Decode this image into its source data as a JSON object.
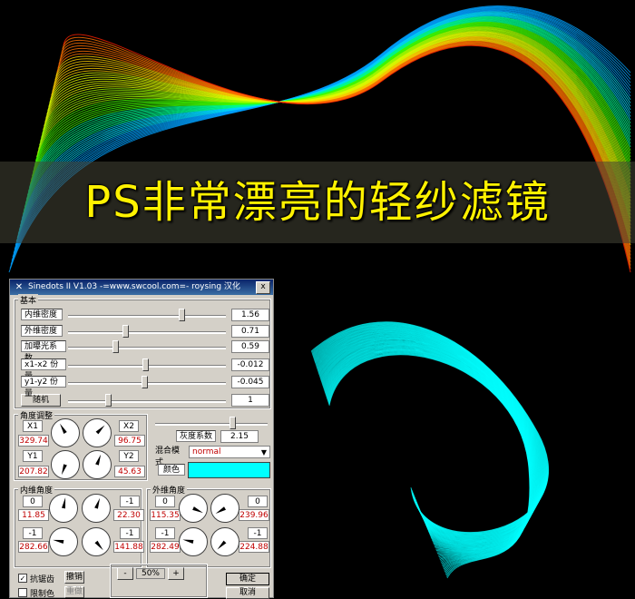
{
  "banner": {
    "title": "PS非常漂亮的轻纱滤镜"
  },
  "window": {
    "title": "Sinedots II V1.03 -=www.swcool.com=- roysing 汉化",
    "close_glyph": "x",
    "section_basic": "基本",
    "params": [
      {
        "label": "内维密度",
        "value": "1.56",
        "level": 0.72
      },
      {
        "label": "外维密度",
        "value": "0.71",
        "level": 0.36
      },
      {
        "label": "加曝光系数",
        "value": "0.59",
        "level": 0.3
      },
      {
        "label": "x1-x2 份量",
        "value": "-0.012",
        "level": 0.49
      },
      {
        "label": "y1-y2 份量",
        "value": "-0.045",
        "level": 0.48
      }
    ],
    "random_button": "随机",
    "random_value": "1",
    "random_level": 0.25,
    "angle_title": "角度调整",
    "angle": {
      "x1_label": "X1",
      "x1_value": "329.74",
      "x2_label": "X2",
      "x2_value": "96.75",
      "y1_label": "Y1",
      "y1_value": "207.82",
      "y2_label": "Y2",
      "y2_value": "45.63"
    },
    "gray_label": "灰度系数",
    "gray_value": "2.15",
    "blend_label": "混合模式",
    "blend_value": "normal",
    "color_label": "颜色",
    "color_hex": "#00ffff",
    "inner_title": "内维角度",
    "inner": {
      "a": "0",
      "b": "11.85",
      "c": "-1",
      "d": "22.30",
      "e": "-1",
      "f": "282.66",
      "g": "-1",
      "h": "141.88"
    },
    "outer_title": "外维角度",
    "outer": {
      "a": "0",
      "b": "115.35",
      "c": "0",
      "d": "239.96",
      "e": "-1",
      "f": "282.49",
      "g": "-1",
      "h": "224.88"
    },
    "antialias_label": "抗锯齿",
    "antialias_checked": "✓",
    "limit_label": "限制色",
    "undo_button": "撤销",
    "redo_button": "重做",
    "zoom_minus": "-",
    "zoom_value": "50%",
    "zoom_plus": "+",
    "ok_button": "确定",
    "cancel_button": "取消"
  },
  "colors": {
    "accent": "#00ffff",
    "title_text": "#fff200",
    "red_values": "#c00000"
  }
}
